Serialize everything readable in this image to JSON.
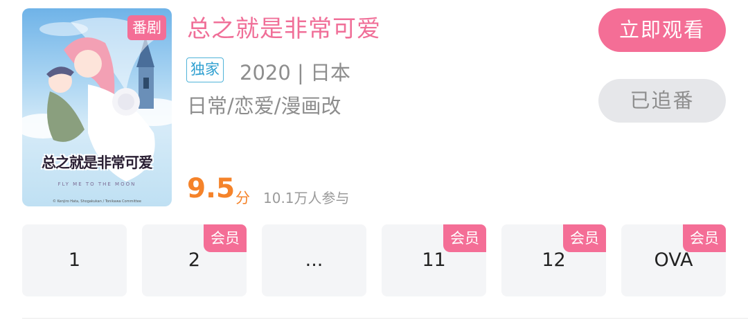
{
  "poster": {
    "badge": "番剧",
    "logo_text": "总之就是非常可爱",
    "logo_subtext": "FLY ME TO THE MOON",
    "copyright": "© Kenjiro Hata, Shogakukan / Tonikawa Committee"
  },
  "show": {
    "title": "总之就是非常可爱",
    "exclusive_tag": "独家",
    "year_region": "2020 | 日本",
    "genres": "日常/恋爱/漫画改",
    "score": "9.5",
    "score_unit": "分",
    "participants": "10.1万人参与"
  },
  "actions": {
    "watch_label": "立即观看",
    "follow_label": "已追番"
  },
  "episodes": [
    {
      "label": "1",
      "vip": ""
    },
    {
      "label": "2",
      "vip": "会员"
    },
    {
      "label": "...",
      "vip": ""
    },
    {
      "label": "11",
      "vip": "会员"
    },
    {
      "label": "12",
      "vip": "会员"
    },
    {
      "label": "OVA",
      "vip": "会员"
    }
  ],
  "colors": {
    "accent": "#f46e96",
    "score": "#f5832a",
    "exclusive": "#2e9fd0",
    "muted": "#8d8d8d"
  }
}
